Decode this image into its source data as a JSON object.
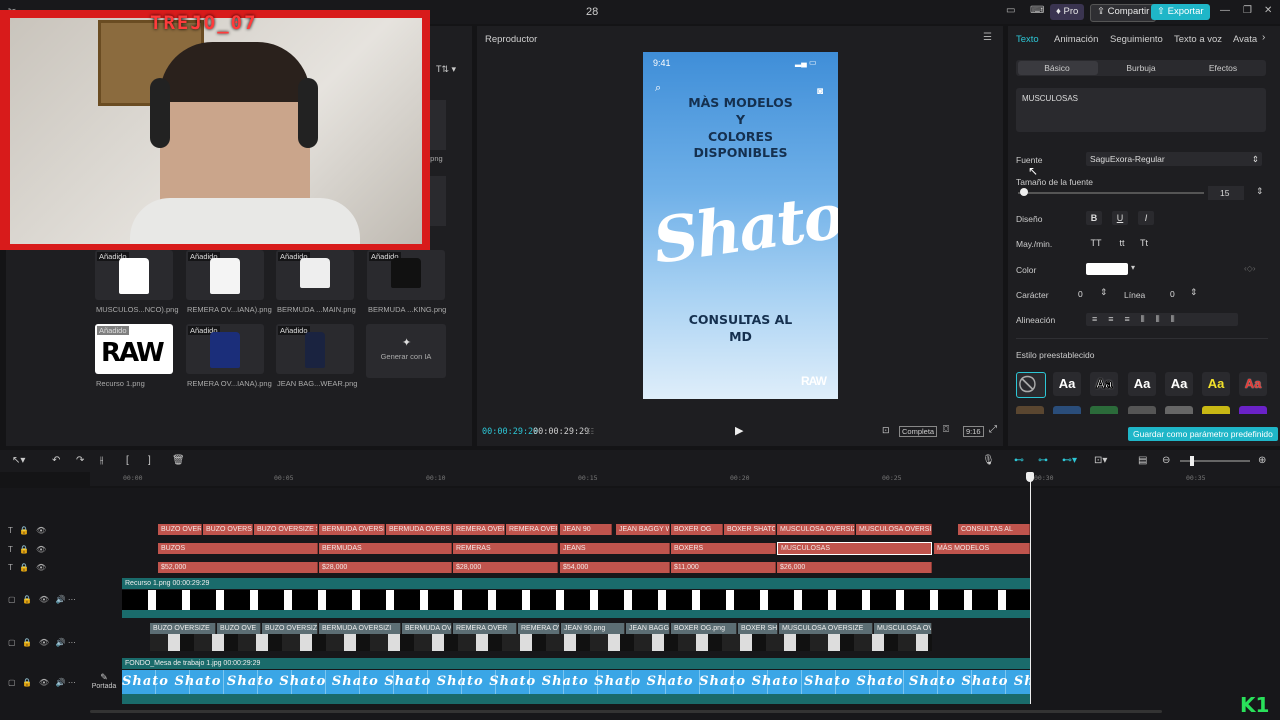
{
  "topbar": {
    "title": "28",
    "pro": "Pro",
    "share": "Compartir",
    "export": "Exportar"
  },
  "webcam": {
    "name": "TREJO_07"
  },
  "media": {
    "items": [
      {
        "added": "Añadido",
        "label": "MUSCULOS...NCO).png",
        "color": "#ffffff"
      },
      {
        "added": "Añadido",
        "label": "REMERA OV...IANA).png",
        "color": "#f4f4f4"
      },
      {
        "added": "Añadido",
        "label": "BERMUDA ...MAIN.png",
        "color": "#eeeeee"
      },
      {
        "added": "Añadido",
        "label": "BERMUDA ...KING.png",
        "color": "#111111"
      },
      {
        "added": "Añadido",
        "label": "Recurso 1.png",
        "color": "#ffffff"
      },
      {
        "added": "Añadido",
        "label": "REMERA OV...IANA).png",
        "color": "#1b2e7a"
      },
      {
        "added": "Añadido",
        "label": "JEAN BAG...WEAR.png",
        "color": "#1a2340"
      }
    ],
    "partial_label": "..png",
    "generate": "Generar con IA"
  },
  "player": {
    "title": "Reproductor",
    "time_current": "00:00:29:29",
    "time_total": "00:00:29:29",
    "full": "Completa",
    "ratio": "9:16",
    "phone": {
      "clock": "9:41",
      "headline_1": "MÀS MODELOS",
      "headline_2": "Y",
      "headline_3": "COLORES",
      "headline_4": "DISPONIBLES",
      "logo": "Shato",
      "footer_1": "CONSULTAS AL",
      "footer_2": "MD",
      "mark": "RAW"
    }
  },
  "props": {
    "tabs": [
      "Texto",
      "Animación",
      "Seguimiento",
      "Texto a voz",
      "Avata"
    ],
    "subtabs": [
      "Básico",
      "Burbuja",
      "Efectos"
    ],
    "text_value": "MUSCULOSAS",
    "font_label": "Fuente",
    "font_value": "SaguExora-Regular",
    "size_label": "Tamaño de la fuente",
    "size_value": "15",
    "design_label": "Diseño",
    "design_b": "B",
    "design_u": "U",
    "design_i": "I",
    "case_label": "May./min.",
    "case_upper": "TT",
    "case_lower": "tt",
    "case_title": "Tt",
    "color_label": "Color",
    "char_label": "Carácter",
    "char_value": "0",
    "line_label": "Línea",
    "line_value": "0",
    "align_label": "Alineación",
    "preset_label": "Estilo preestablecido",
    "preset_sample": "Aa",
    "save_preset": "Guardar como parámetro predefinido"
  },
  "timeline": {
    "ticks": [
      "00:00",
      "00:05",
      "00:10",
      "00:15",
      "00:20",
      "00:25",
      "00:30",
      "00:35"
    ],
    "track1": [
      "BUZO OVERSI",
      "BUZO OVERSIZ",
      "BUZO OVERSIZE SL",
      "BERMUDA OVERSIZ",
      "BERMUDA OVERSIZ",
      "REMERA OVERS",
      "REMERA OVERS",
      "JEAN 90",
      "JEAN BAGGY W",
      "BOXER OG",
      "BOXER SHATO",
      "MUSCULOSA OVERSIZE",
      "MUSCULOSA OVERSIZE",
      "CONSULTAS AL"
    ],
    "track2": [
      "BUZOS",
      "BERMUDAS",
      "REMERAS",
      "JEANS",
      "BOXERS",
      "MUSCULOSAS",
      "MÀS MODELOS"
    ],
    "track3": [
      "$52,000",
      "$28,000",
      "$28,000",
      "$54,000",
      "$11,000",
      "$26,000"
    ],
    "raw_clip": "Recurso 1.png  00:00:29:29",
    "video_clips": [
      "BUZO OVERSIZE",
      "BUZO OVE",
      "BUZO OVERSIZE",
      "BERMUDA OVERSIZI",
      "BERMUDA OVE",
      "REMERA OVER",
      "REMERA OV",
      "JEAN 90.png",
      "JEAN BAGG",
      "BOXER OG.png",
      "BOXER SHA",
      "MUSCULOSA OVERSIZE",
      "MUSCULOSA OVE"
    ],
    "bg_clip": "FONDO_Mesa de trabajo 1.jpg  00:00:29:29",
    "bg_pattern": "Shato Shato Shato Shato Shato Shato Shato Shato Shato Shato Shato Shato Shato Shato Shato Shato Shato Shato Shato Shato Shato Shato Shato Shato Shato Shato Shato",
    "cover": "Portada"
  },
  "watermark": "K1"
}
